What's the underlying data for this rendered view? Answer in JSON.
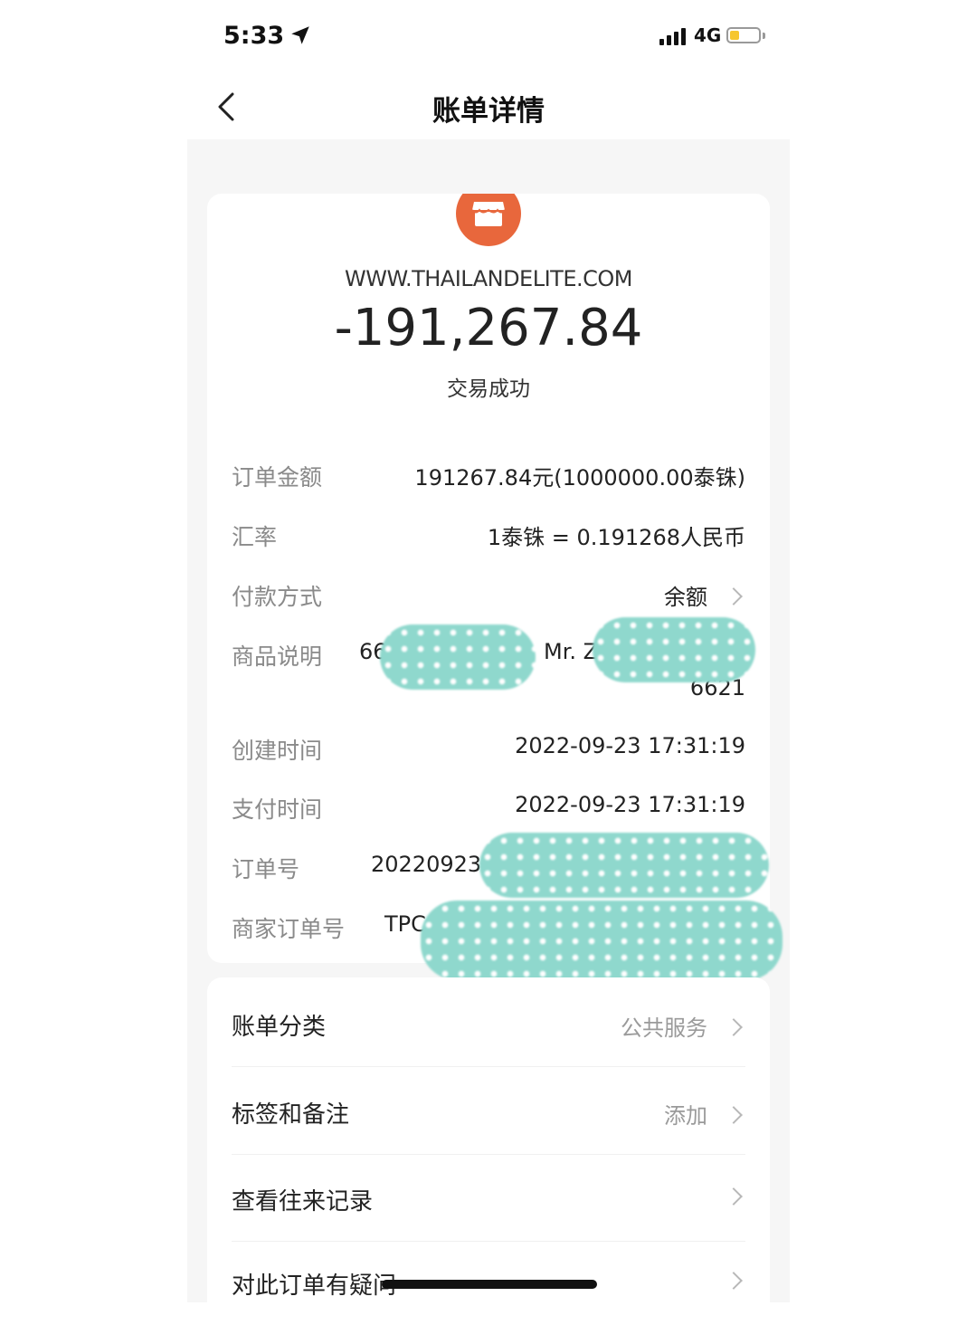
{
  "status_bar": {
    "time": "5:33",
    "network": "4G"
  },
  "nav": {
    "title": "账单详情",
    "back_icon": "chevron-left-icon"
  },
  "summary": {
    "merchant_icon": "store-icon",
    "merchant": "WWW.THAILANDELITE.COM",
    "amount": "-191,267.84",
    "status": "交易成功"
  },
  "details": {
    "order_amount": {
      "label": "订单金额",
      "value": "191267.84元(1000000.00泰铢)"
    },
    "exchange_rate": {
      "label": "汇率",
      "value": "1泰铢 = 0.191268人民币"
    },
    "payment_method": {
      "label": "付款方式",
      "value": "余额"
    },
    "product_desc": {
      "label": "商品说明",
      "value_part1": "66",
      "value_part2": "Mr. Z",
      "value_line2": "6621"
    },
    "created_time": {
      "label": "创建时间",
      "value": "2022-09-23 17:31:19"
    },
    "paid_time": {
      "label": "支付时间",
      "value": "2022-09-23 17:31:19"
    },
    "order_no": {
      "label": "订单号",
      "value": "20220923"
    },
    "merchant_order_no": {
      "label": "商家订单号",
      "value": "TPC-"
    }
  },
  "menu": [
    {
      "label": "账单分类",
      "value": "公共服务"
    },
    {
      "label": "标签和备注",
      "value": "添加"
    },
    {
      "label": "查看往来记录",
      "value": ""
    },
    {
      "label": "对此订单有疑问",
      "value": ""
    }
  ],
  "colors": {
    "accent_orange": "#e8673c",
    "redaction": "#8fd8cd",
    "battery": "#f6c62e"
  }
}
